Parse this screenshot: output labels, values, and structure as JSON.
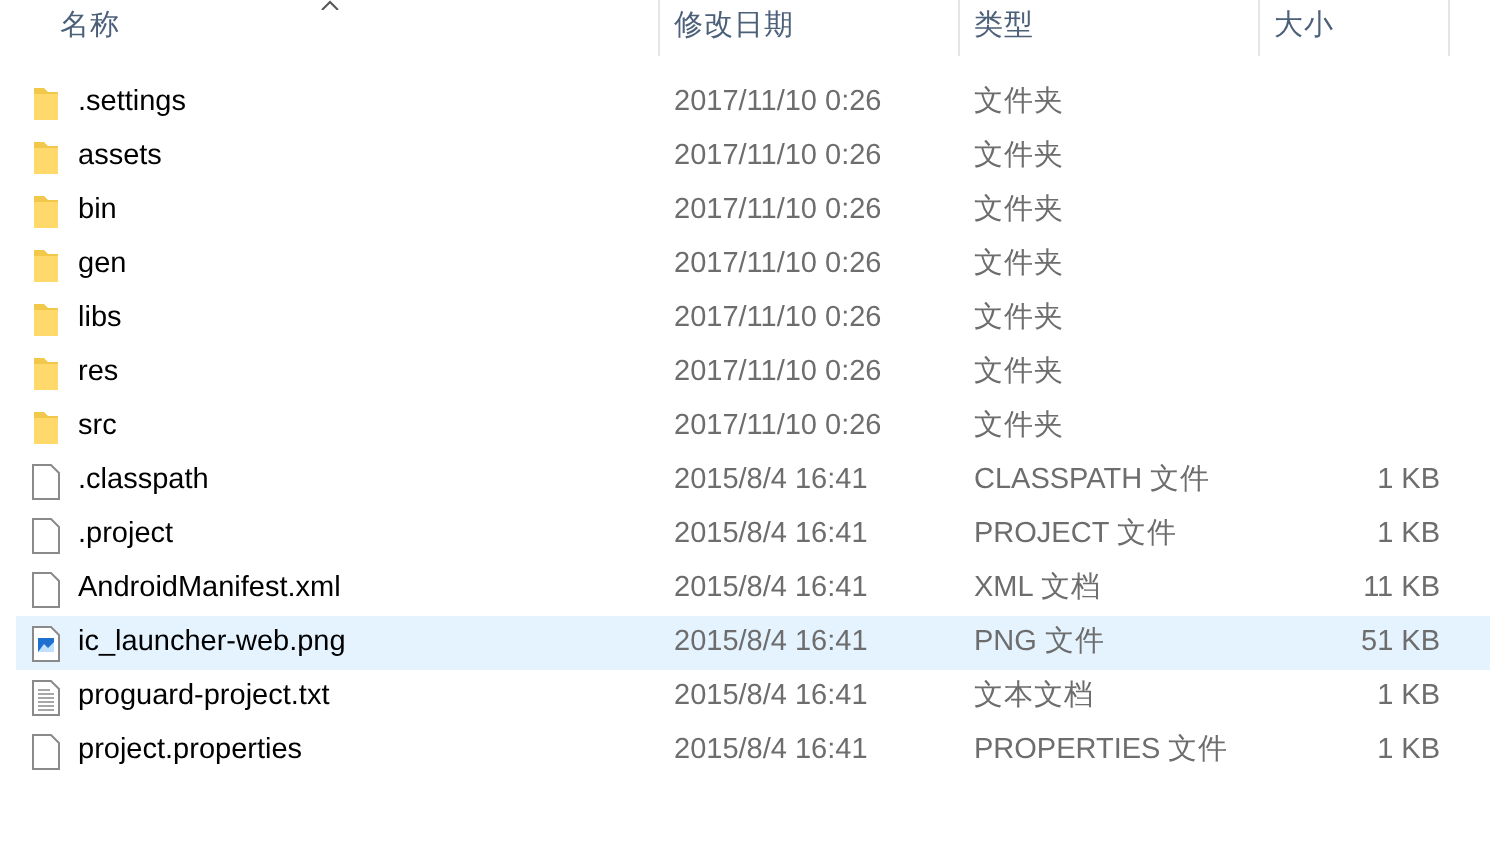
{
  "columns": [
    {
      "label": "名称",
      "sorted": true
    },
    {
      "label": "修改日期",
      "sorted": false
    },
    {
      "label": "类型",
      "sorted": false
    },
    {
      "label": "大小",
      "sorted": false
    }
  ],
  "rows": [
    {
      "kind": "folder",
      "name": ".settings",
      "date": "2017/11/10 0:26",
      "type": "文件夹",
      "selected": false
    },
    {
      "kind": "folder",
      "name": "assets",
      "date": "2017/11/10 0:26",
      "type": "文件夹",
      "selected": false
    },
    {
      "kind": "folder",
      "name": "bin",
      "date": "2017/11/10 0:26",
      "type": "文件夹",
      "selected": false
    },
    {
      "kind": "folder",
      "name": "gen",
      "date": "2017/11/10 0:26",
      "type": "文件夹",
      "selected": false
    },
    {
      "kind": "folder",
      "name": "libs",
      "date": "2017/11/10 0:26",
      "type": "文件夹",
      "selected": false
    },
    {
      "kind": "folder",
      "name": "res",
      "date": "2017/11/10 0:26",
      "type": "文件夹",
      "selected": false
    },
    {
      "kind": "folder",
      "name": "src",
      "date": "2017/11/10 0:26",
      "type": "文件夹",
      "selected": false
    },
    {
      "kind": "file",
      "name": ".classpath",
      "date": "2015/8/4 16:41",
      "type": "CLASSPATH 文件",
      "size": "1 KB",
      "selected": false
    },
    {
      "kind": "file",
      "name": ".project",
      "date": "2015/8/4 16:41",
      "type": "PROJECT 文件",
      "size": "1 KB",
      "selected": false
    },
    {
      "kind": "file",
      "name": "AndroidManifest.xml",
      "date": "2015/8/4 16:41",
      "type": "XML 文档",
      "size": "11 KB",
      "selected": false
    },
    {
      "kind": "image",
      "name": "ic_launcher-web.png",
      "date": "2015/8/4 16:41",
      "type": "PNG 文件",
      "size": "51 KB",
      "selected": true
    },
    {
      "kind": "text",
      "name": "proguard-project.txt",
      "date": "2015/8/4 16:41",
      "type": "文本文档",
      "size": "1 KB",
      "selected": false
    },
    {
      "kind": "file",
      "name": "project.properties",
      "date": "2015/8/4 16:41",
      "type": "PROPERTIES 文件",
      "size": "1 KB",
      "selected": false
    }
  ]
}
